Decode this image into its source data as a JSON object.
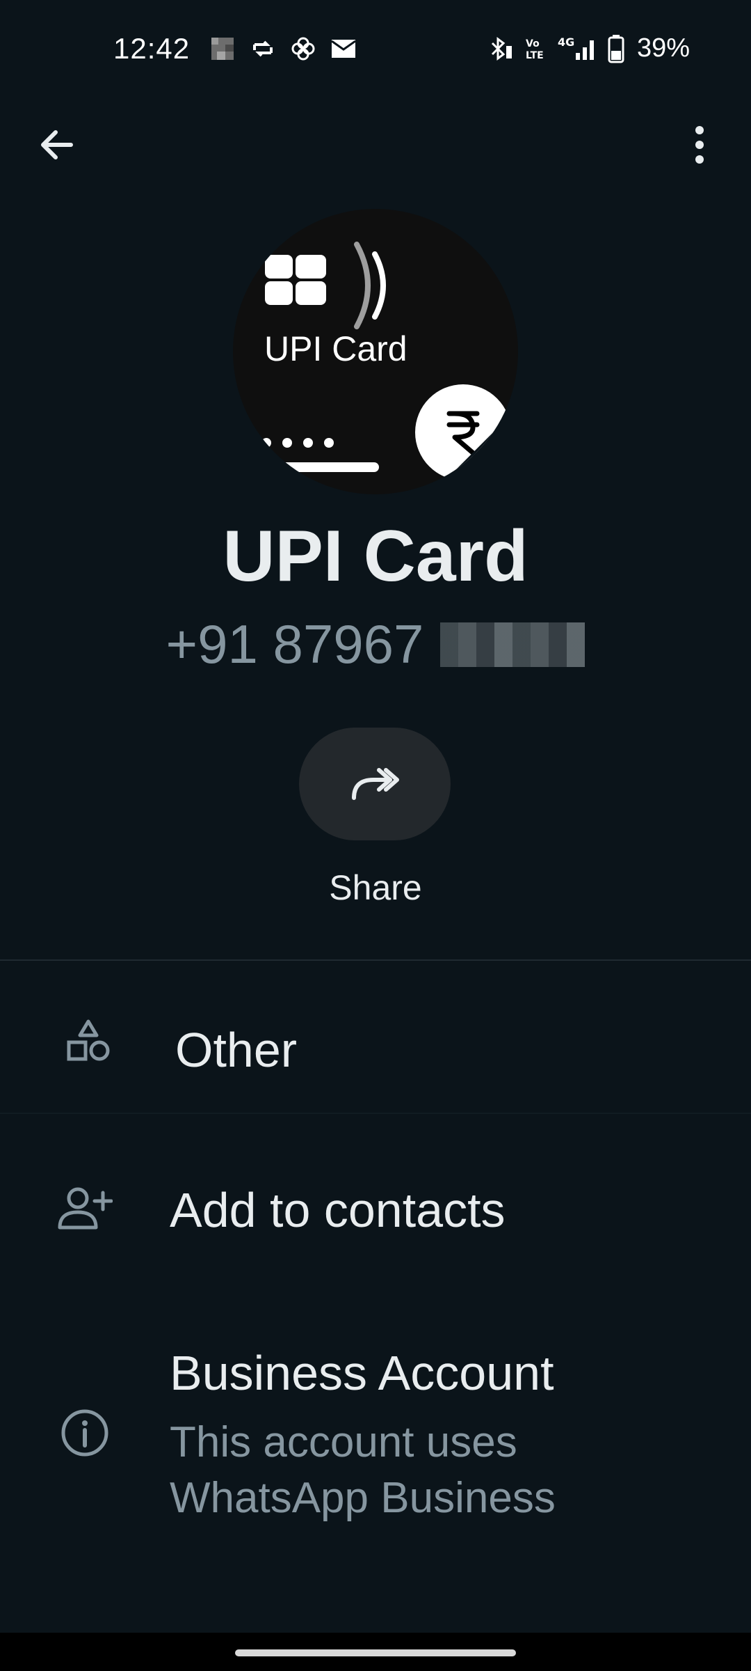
{
  "status_bar": {
    "time": "12:42",
    "battery": "39%",
    "network": "4G"
  },
  "profile": {
    "avatar_text": "UPI Card",
    "name": "UPI Card",
    "phone": "+91 87967"
  },
  "actions": {
    "share_label": "Share"
  },
  "list": {
    "category": "Other",
    "add_contact": "Add to contacts",
    "business_title": "Business Account",
    "business_line1": "This account uses",
    "business_line2": "WhatsApp Business"
  },
  "colors": {
    "background": "#0b141a",
    "primary_text": "#e9edef",
    "secondary_text": "#8696a0",
    "button_bg": "#23282c"
  }
}
